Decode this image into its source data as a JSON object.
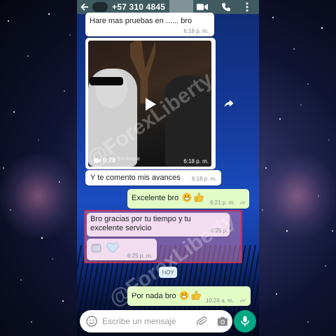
{
  "header": {
    "contact_name": "+57 310 4845"
  },
  "messages": [
    {
      "id": "m1",
      "text": "Hare mas pruebas en ...... bro",
      "time": "6:18 p. m."
    },
    {
      "id": "video",
      "duration": "0:28",
      "label": "Mr. Bombastic",
      "time": "6:18 p. m."
    },
    {
      "id": "m2",
      "text": "Y te comento mis avances",
      "time": "6:18 p. m."
    },
    {
      "id": "m3",
      "text": "Excelente bro",
      "time": "6:21 p. m."
    },
    {
      "id": "m4",
      "text": "Bro gracias por tu tiempo y tu excelente servicio",
      "time": "6:25 p. m."
    },
    {
      "id": "m5",
      "time": "6:25 p. m."
    },
    {
      "id": "m6",
      "text": "Por nada bro",
      "time": "10:24 a. m."
    }
  ],
  "day_chip": "HOY",
  "composer": {
    "placeholder": "Escribe un mensaje"
  },
  "watermark": "@ForexLiberty",
  "colors": {
    "header": "#3f5b61",
    "outgoing_bubble": "#e2fcc6",
    "incoming_bubble": "#ffffff",
    "mic_button": "#00a884",
    "highlight_border": "#c0305e"
  },
  "icons": [
    "back-arrow-icon",
    "video-call-icon",
    "phone-icon",
    "more-vert-icon",
    "play-icon",
    "share-icon",
    "emoji-icon",
    "attach-icon",
    "camera-icon",
    "mic-icon"
  ]
}
